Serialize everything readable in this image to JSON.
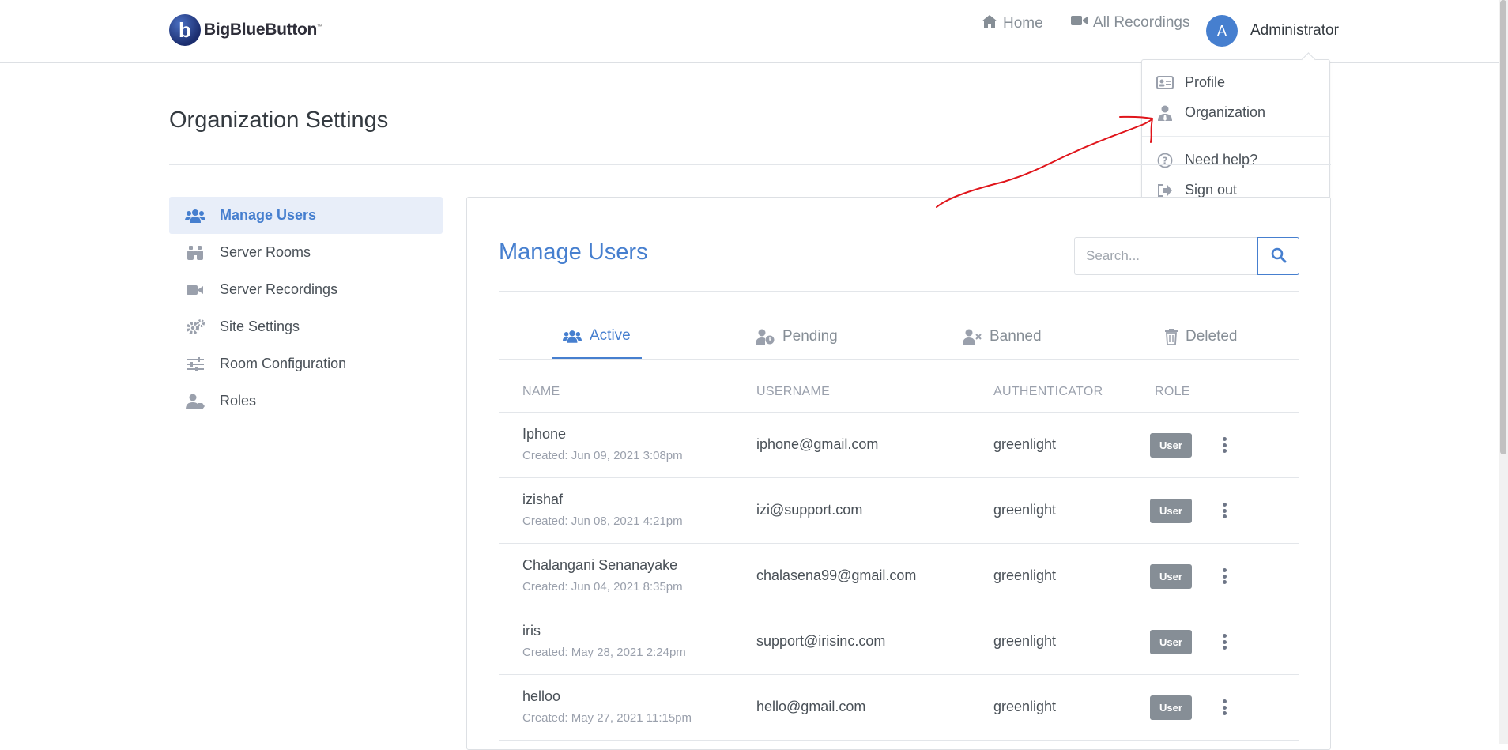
{
  "brand": {
    "name": "BigBlueButton",
    "mark": "b",
    "tm": "™"
  },
  "nav": {
    "home": "Home",
    "recordings": "All Recordings",
    "user_initial": "A",
    "user_name": "Administrator"
  },
  "dropdown": {
    "profile": "Profile",
    "organization": "Organization",
    "help": "Need help?",
    "signout": "Sign out"
  },
  "page": {
    "title": "Organization Settings"
  },
  "sidebar": {
    "items": [
      {
        "label": "Manage Users",
        "icon": "users-icon",
        "active": true
      },
      {
        "label": "Server Rooms",
        "icon": "binoculars-icon"
      },
      {
        "label": "Server Recordings",
        "icon": "video-icon"
      },
      {
        "label": "Site Settings",
        "icon": "cogs-icon"
      },
      {
        "label": "Room Configuration",
        "icon": "sliders-icon"
      },
      {
        "label": "Roles",
        "icon": "user-tag-icon"
      }
    ]
  },
  "main": {
    "title": "Manage Users",
    "search_placeholder": "Search...",
    "tabs": [
      {
        "label": "Active",
        "active": true
      },
      {
        "label": "Pending"
      },
      {
        "label": "Banned"
      },
      {
        "label": "Deleted"
      }
    ],
    "columns": [
      "NAME",
      "USERNAME",
      "AUTHENTICATOR",
      "ROLE"
    ],
    "rows": [
      {
        "name": "Iphone",
        "created": "Created: Jun 09, 2021 3:08pm",
        "username": "iphone@gmail.com",
        "auth": "greenlight",
        "role": "User"
      },
      {
        "name": "izishaf",
        "created": "Created: Jun 08, 2021 4:21pm",
        "username": "izi@support.com",
        "auth": "greenlight",
        "role": "User"
      },
      {
        "name": "Chalangani Senanayake",
        "created": "Created: Jun 04, 2021 8:35pm",
        "username": "chalasena99@gmail.com",
        "auth": "greenlight",
        "role": "User"
      },
      {
        "name": "iris",
        "created": "Created: May 28, 2021 2:24pm",
        "username": "support@irisinc.com",
        "auth": "greenlight",
        "role": "User"
      },
      {
        "name": "helloo",
        "created": "Created: May 27, 2021 11:15pm",
        "username": "hello@gmail.com",
        "auth": "greenlight",
        "role": "User"
      }
    ]
  },
  "colors": {
    "accent": "#467fcf",
    "badge": "#868e96",
    "annotation": "#e0151b"
  }
}
